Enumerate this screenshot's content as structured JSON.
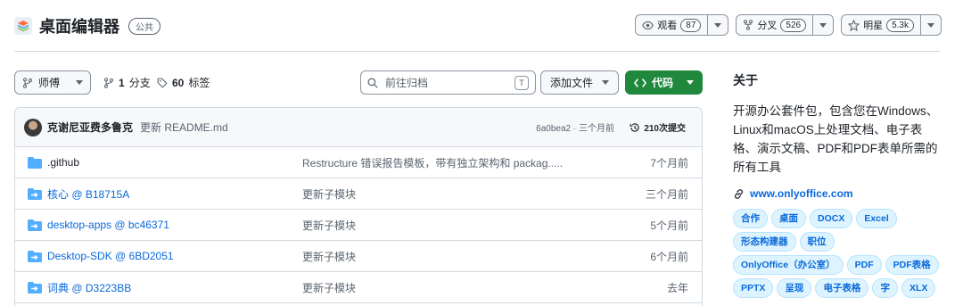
{
  "repo": {
    "title": "桌面编辑器",
    "visibility": "公共"
  },
  "actions": {
    "watch_label": "观看",
    "watch_count": "87",
    "fork_label": "分叉",
    "fork_count": "526",
    "star_label": "明星",
    "star_count": "5.3k"
  },
  "toolbar": {
    "branch_label": "师傅",
    "branches_count": "1",
    "branches_label": "分支",
    "tags_count": "60",
    "tags_label": "标签",
    "search_placeholder": "前往归档",
    "search_shortcut": "T",
    "add_file_label": "添加文件",
    "code_label": "代码"
  },
  "commit": {
    "author": "克谢尼亚费多鲁克",
    "message": "更新 README.md",
    "meta": "6a0bea2 · 三个月前",
    "count_label": "210次提交"
  },
  "files": [
    {
      "name": ".github",
      "message": "Restructure 错误报告模板，带有独立架构和 packag.....",
      "date": "7个月前",
      "kind": "folder"
    },
    {
      "name": "核心 @ B18715A",
      "message": "更新子模块",
      "date": "三个月前",
      "kind": "submodule"
    },
    {
      "name": "desktop-apps @ bc46371",
      "message": "更新子模块",
      "date": "5个月前",
      "kind": "submodule"
    },
    {
      "name": "Desktop-SDK @ 6BD2051",
      "message": "更新子模块",
      "date": "6个月前",
      "kind": "submodule"
    },
    {
      "name": "词典 @ D3223BB",
      "message": "更新子模块",
      "date": "去年",
      "kind": "submodule"
    }
  ],
  "about": {
    "title": "关于",
    "description": "开源办公套件包，包含您在Windows、Linux和macOS上处理文档、电子表格、演示文稿、PDF和PDF表单所需的所有工具",
    "link": "www.onlyoffice.com",
    "topics": [
      "合作",
      "桌面",
      "DOCX",
      "Excel",
      "形态构建器",
      "职位",
      "OnlyOffice（办公室）",
      "PDF",
      "PDF表格",
      "PPTX",
      "呈现",
      "电子表格",
      "字",
      "XLX"
    ]
  },
  "colors": {
    "accent": "#0969da",
    "code_button": "#1f883d",
    "folder_icon": "#54aeff"
  }
}
